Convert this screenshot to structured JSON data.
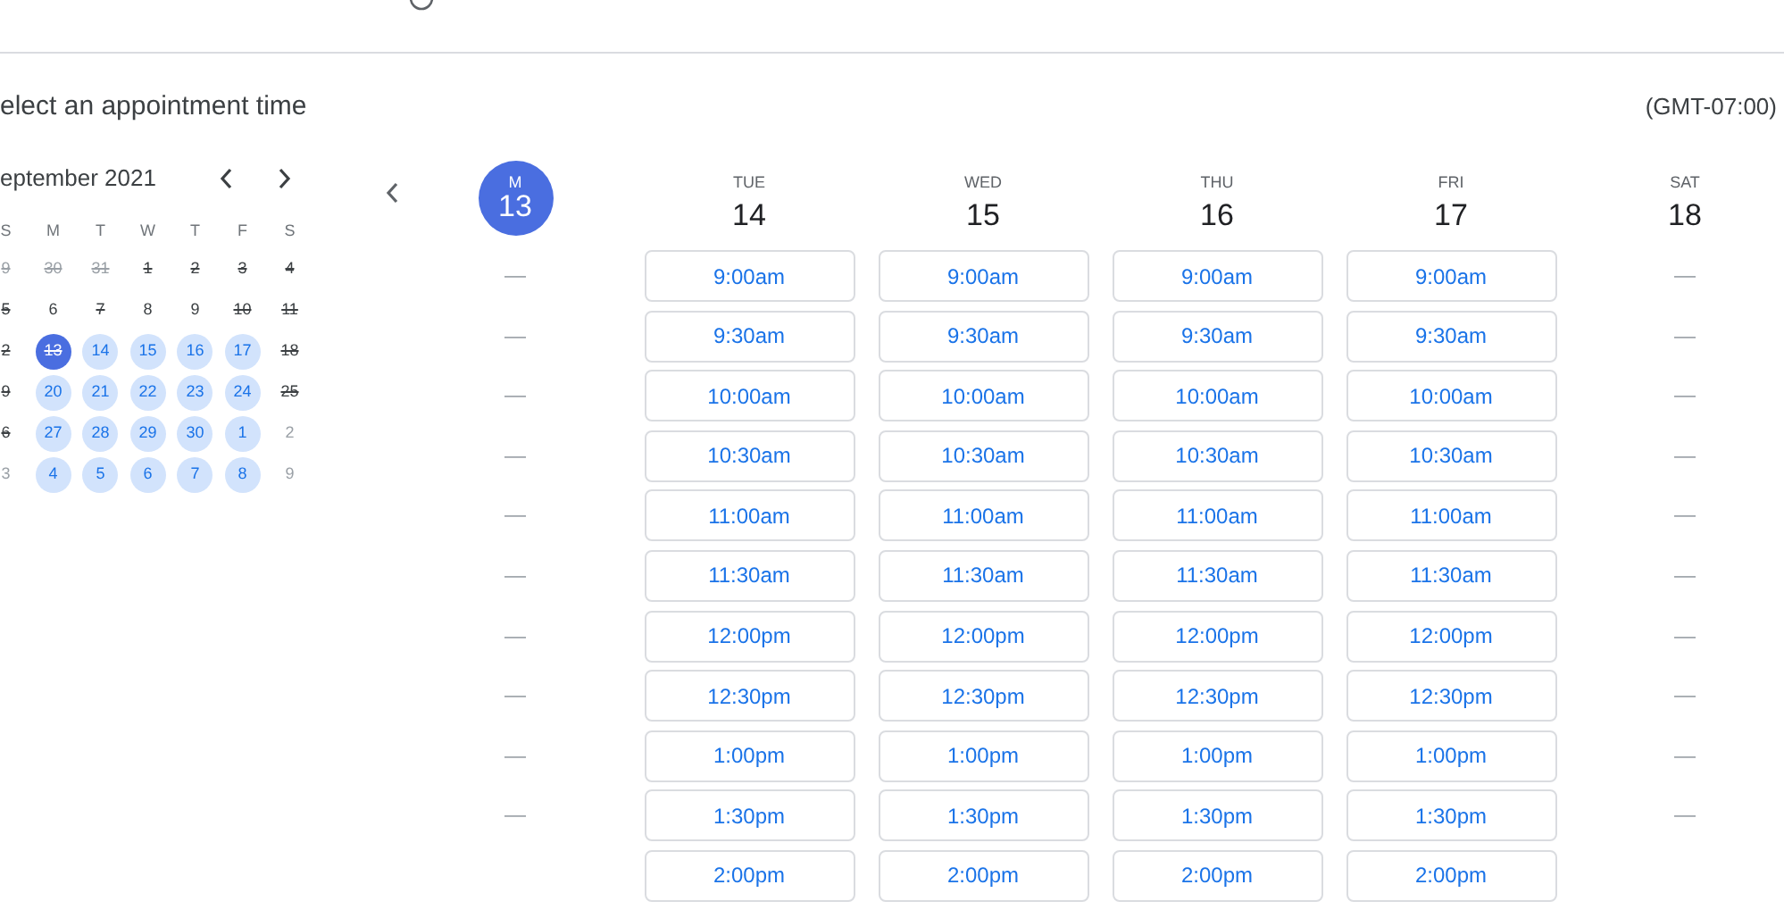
{
  "title": "elect an appointment time",
  "timezone": "(GMT-07:00)",
  "mini_calendar": {
    "month": "eptember 2021",
    "weekdays": [
      "S",
      "M",
      "T",
      "W",
      "T",
      "F",
      "S"
    ],
    "weeks": [
      [
        {
          "label": "9",
          "struck": true,
          "muted": true,
          "available": false,
          "selected": false
        },
        {
          "label": "30",
          "struck": true,
          "muted": true,
          "available": false,
          "selected": false
        },
        {
          "label": "31",
          "struck": true,
          "muted": true,
          "available": false,
          "selected": false
        },
        {
          "label": "1",
          "struck": true,
          "muted": false,
          "available": false,
          "selected": false
        },
        {
          "label": "2",
          "struck": true,
          "muted": false,
          "available": false,
          "selected": false
        },
        {
          "label": "3",
          "struck": true,
          "muted": false,
          "available": false,
          "selected": false
        },
        {
          "label": "4",
          "struck": true,
          "muted": false,
          "available": false,
          "selected": false
        }
      ],
      [
        {
          "label": "5",
          "struck": true,
          "muted": false,
          "available": false,
          "selected": false
        },
        {
          "label": "6",
          "struck": false,
          "muted": false,
          "available": false,
          "selected": false
        },
        {
          "label": "7",
          "struck": true,
          "muted": false,
          "available": false,
          "selected": false
        },
        {
          "label": "8",
          "struck": false,
          "muted": false,
          "available": false,
          "selected": false
        },
        {
          "label": "9",
          "struck": false,
          "muted": false,
          "available": false,
          "selected": false
        },
        {
          "label": "10",
          "struck": true,
          "muted": false,
          "available": false,
          "selected": false
        },
        {
          "label": "11",
          "struck": true,
          "muted": false,
          "available": false,
          "selected": false
        }
      ],
      [
        {
          "label": "2",
          "struck": true,
          "muted": false,
          "available": false,
          "selected": false
        },
        {
          "label": "13",
          "struck": true,
          "muted": false,
          "available": false,
          "selected": true
        },
        {
          "label": "14",
          "struck": false,
          "muted": false,
          "available": true,
          "selected": false
        },
        {
          "label": "15",
          "struck": false,
          "muted": false,
          "available": true,
          "selected": false
        },
        {
          "label": "16",
          "struck": false,
          "muted": false,
          "available": true,
          "selected": false
        },
        {
          "label": "17",
          "struck": false,
          "muted": false,
          "available": true,
          "selected": false
        },
        {
          "label": "18",
          "struck": true,
          "muted": false,
          "available": false,
          "selected": false
        }
      ],
      [
        {
          "label": "9",
          "struck": true,
          "muted": false,
          "available": false,
          "selected": false
        },
        {
          "label": "20",
          "struck": false,
          "muted": false,
          "available": true,
          "selected": false
        },
        {
          "label": "21",
          "struck": false,
          "muted": false,
          "available": true,
          "selected": false
        },
        {
          "label": "22",
          "struck": false,
          "muted": false,
          "available": true,
          "selected": false
        },
        {
          "label": "23",
          "struck": false,
          "muted": false,
          "available": true,
          "selected": false
        },
        {
          "label": "24",
          "struck": false,
          "muted": false,
          "available": true,
          "selected": false
        },
        {
          "label": "25",
          "struck": true,
          "muted": false,
          "available": false,
          "selected": false
        }
      ],
      [
        {
          "label": "6",
          "struck": true,
          "muted": false,
          "available": false,
          "selected": false
        },
        {
          "label": "27",
          "struck": false,
          "muted": false,
          "available": true,
          "selected": false
        },
        {
          "label": "28",
          "struck": false,
          "muted": false,
          "available": true,
          "selected": false
        },
        {
          "label": "29",
          "struck": false,
          "muted": false,
          "available": true,
          "selected": false
        },
        {
          "label": "30",
          "struck": false,
          "muted": false,
          "available": true,
          "selected": false
        },
        {
          "label": "1",
          "struck": false,
          "muted": false,
          "available": true,
          "selected": false
        },
        {
          "label": "2",
          "struck": false,
          "muted": true,
          "available": false,
          "selected": false
        }
      ],
      [
        {
          "label": "3",
          "struck": false,
          "muted": true,
          "available": false,
          "selected": false
        },
        {
          "label": "4",
          "struck": false,
          "muted": false,
          "available": true,
          "selected": false
        },
        {
          "label": "5",
          "struck": false,
          "muted": false,
          "available": true,
          "selected": false
        },
        {
          "label": "6",
          "struck": false,
          "muted": false,
          "available": true,
          "selected": false
        },
        {
          "label": "7",
          "struck": false,
          "muted": false,
          "available": true,
          "selected": false
        },
        {
          "label": "8",
          "struck": false,
          "muted": false,
          "available": true,
          "selected": false
        },
        {
          "label": "9",
          "struck": false,
          "muted": true,
          "available": false,
          "selected": false
        }
      ]
    ]
  },
  "week": [
    {
      "day": "M",
      "date": "13",
      "selected": true,
      "slots": [
        {
          "kind": "none",
          "text": "—"
        },
        {
          "kind": "none",
          "text": "—"
        },
        {
          "kind": "none",
          "text": "—"
        },
        {
          "kind": "none",
          "text": "—"
        },
        {
          "kind": "none",
          "text": "—"
        },
        {
          "kind": "none",
          "text": "—"
        },
        {
          "kind": "none",
          "text": "—"
        },
        {
          "kind": "none",
          "text": "—"
        },
        {
          "kind": "none",
          "text": "—"
        },
        {
          "kind": "none",
          "text": "—"
        }
      ]
    },
    {
      "day": "TUE",
      "date": "14",
      "selected": false,
      "slots": [
        {
          "kind": "time",
          "text": "9:00am"
        },
        {
          "kind": "time",
          "text": "9:30am"
        },
        {
          "kind": "time",
          "text": "10:00am"
        },
        {
          "kind": "time",
          "text": "10:30am"
        },
        {
          "kind": "time",
          "text": "11:00am"
        },
        {
          "kind": "time",
          "text": "11:30am"
        },
        {
          "kind": "time",
          "text": "12:00pm"
        },
        {
          "kind": "time",
          "text": "12:30pm"
        },
        {
          "kind": "time",
          "text": "1:00pm"
        },
        {
          "kind": "time",
          "text": "1:30pm"
        },
        {
          "kind": "time",
          "text": "2:00pm"
        }
      ]
    },
    {
      "day": "WED",
      "date": "15",
      "selected": false,
      "slots": [
        {
          "kind": "time",
          "text": "9:00am"
        },
        {
          "kind": "time",
          "text": "9:30am"
        },
        {
          "kind": "time",
          "text": "10:00am"
        },
        {
          "kind": "time",
          "text": "10:30am"
        },
        {
          "kind": "time",
          "text": "11:00am"
        },
        {
          "kind": "time",
          "text": "11:30am"
        },
        {
          "kind": "time",
          "text": "12:00pm"
        },
        {
          "kind": "time",
          "text": "12:30pm"
        },
        {
          "kind": "time",
          "text": "1:00pm"
        },
        {
          "kind": "time",
          "text": "1:30pm"
        },
        {
          "kind": "time",
          "text": "2:00pm"
        }
      ]
    },
    {
      "day": "THU",
      "date": "16",
      "selected": false,
      "slots": [
        {
          "kind": "time",
          "text": "9:00am"
        },
        {
          "kind": "time",
          "text": "9:30am"
        },
        {
          "kind": "time",
          "text": "10:00am"
        },
        {
          "kind": "time",
          "text": "10:30am"
        },
        {
          "kind": "time",
          "text": "11:00am"
        },
        {
          "kind": "time",
          "text": "11:30am"
        },
        {
          "kind": "time",
          "text": "12:00pm"
        },
        {
          "kind": "time",
          "text": "12:30pm"
        },
        {
          "kind": "time",
          "text": "1:00pm"
        },
        {
          "kind": "time",
          "text": "1:30pm"
        },
        {
          "kind": "time",
          "text": "2:00pm"
        }
      ]
    },
    {
      "day": "FRI",
      "date": "17",
      "selected": false,
      "slots": [
        {
          "kind": "time",
          "text": "9:00am"
        },
        {
          "kind": "time",
          "text": "9:30am"
        },
        {
          "kind": "time",
          "text": "10:00am"
        },
        {
          "kind": "time",
          "text": "10:30am"
        },
        {
          "kind": "time",
          "text": "11:00am"
        },
        {
          "kind": "time",
          "text": "11:30am"
        },
        {
          "kind": "time",
          "text": "12:00pm"
        },
        {
          "kind": "time",
          "text": "12:30pm"
        },
        {
          "kind": "time",
          "text": "1:00pm"
        },
        {
          "kind": "time",
          "text": "1:30pm"
        },
        {
          "kind": "time",
          "text": "2:00pm"
        }
      ]
    },
    {
      "day": "SAT",
      "date": "18",
      "selected": false,
      "slots": [
        {
          "kind": "none",
          "text": "—"
        },
        {
          "kind": "none",
          "text": "—"
        },
        {
          "kind": "none",
          "text": "—"
        },
        {
          "kind": "none",
          "text": "—"
        },
        {
          "kind": "none",
          "text": "—"
        },
        {
          "kind": "none",
          "text": "—"
        },
        {
          "kind": "none",
          "text": "—"
        },
        {
          "kind": "none",
          "text": "—"
        },
        {
          "kind": "none",
          "text": "—"
        },
        {
          "kind": "none",
          "text": "—"
        }
      ]
    }
  ]
}
